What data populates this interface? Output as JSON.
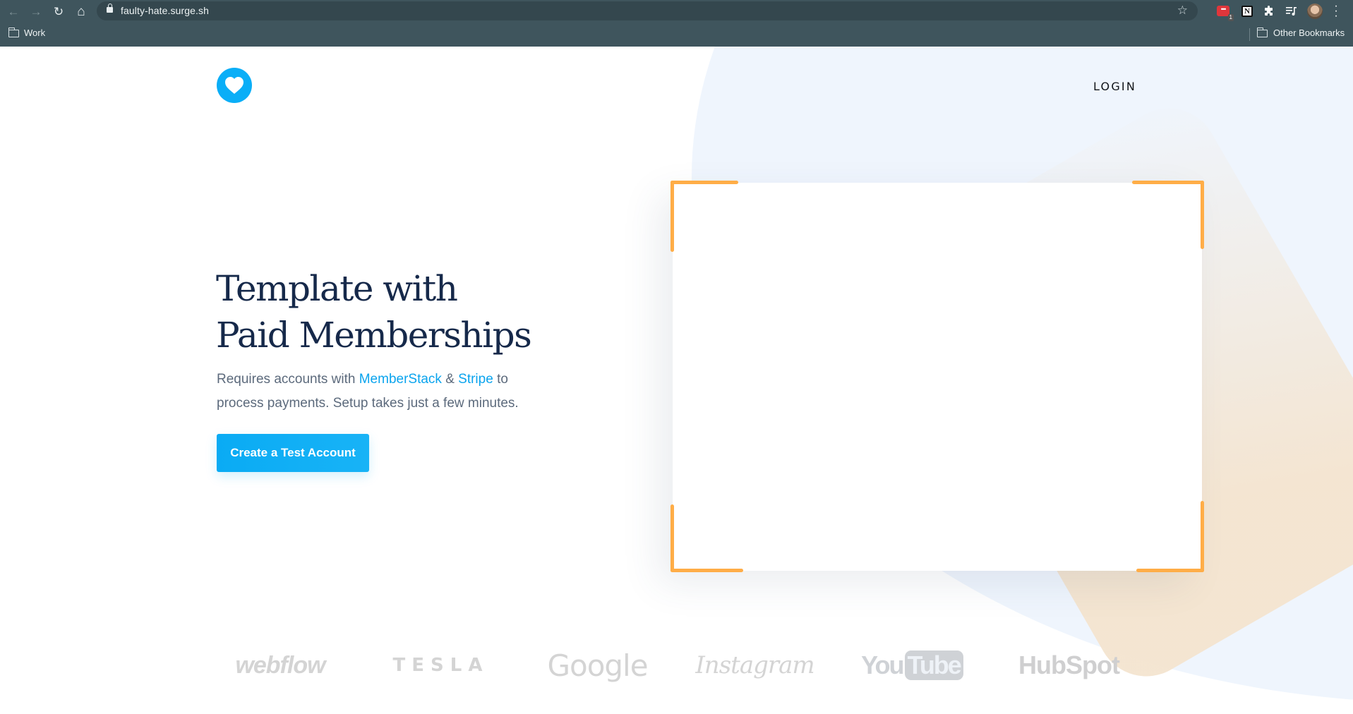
{
  "browser": {
    "url": "faulty-hate.surge.sh",
    "bookmarks": [
      {
        "label": "Work",
        "icon": "folder-icon"
      }
    ],
    "other_bookmarks_label": "Other Bookmarks",
    "extensions": [
      {
        "name": "red-extension-icon",
        "badge": "1"
      },
      {
        "name": "notion-icon",
        "glyph": "N"
      },
      {
        "name": "puzzle-extensions-icon"
      },
      {
        "name": "media-controls-icon"
      }
    ],
    "icons": {
      "back": "←",
      "forward": "→",
      "reload": "↻",
      "home": "⌂",
      "star": "☆",
      "menu": "⋮"
    }
  },
  "header": {
    "logo_icon": "heart-icon",
    "login_label": "LOGIN"
  },
  "hero": {
    "title_line1": "Template with",
    "title_line2": "Paid Memberships",
    "text_prefix": "Requires accounts with ",
    "link1": "MemberStack",
    "text_mid": " & ",
    "link2": "Stripe",
    "text_suffix": " to process payments. Setup takes just a few minutes.",
    "cta_label": "Create a Test Account"
  },
  "brands": {
    "webflow": "webflow",
    "tesla": "TESLA",
    "google": "Google",
    "instagram": "Instagram",
    "youtube_you": "You",
    "youtube_tube": "Tube",
    "hubspot": "HubSpot"
  },
  "colors": {
    "accent": "#0aaef7",
    "heading": "#16294a",
    "body_text": "#5c6a7c",
    "frame_corner": "#ffad47",
    "browser_chrome": "#3f555d"
  }
}
